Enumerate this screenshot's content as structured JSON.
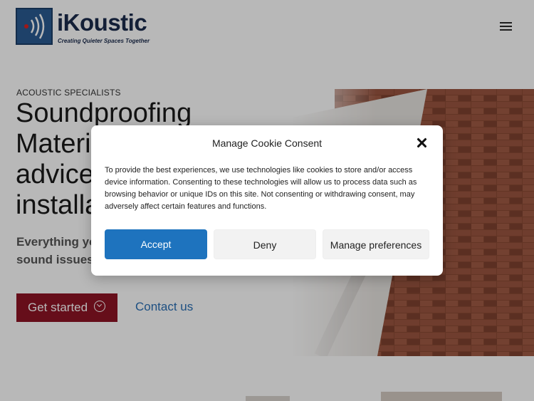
{
  "header": {
    "brand_name": "iKoustic",
    "brand_tagline": "Creating Quieter Spaces Together"
  },
  "hero": {
    "eyebrow": "ACOUSTIC SPECIALISTS",
    "title": "Soundproofing Materials, advice and installation",
    "subtitle": "Everything you need to solve your sound issues in one place.",
    "cta_primary": "Get started",
    "cta_secondary": "Contact us"
  },
  "cookie_modal": {
    "title": "Manage Cookie Consent",
    "body": "To provide the best experiences, we use technologies like cookies to store and/or access device information. Consenting to these technologies will allow us to process data such as browsing behavior or unique IDs on this site. Not consenting or withdrawing consent, may adversely affect certain features and functions.",
    "accept_label": "Accept",
    "deny_label": "Deny",
    "preferences_label": "Manage preferences"
  },
  "colors": {
    "brand_navy": "#1b2b4d",
    "cta_red": "#8e1424",
    "accept_blue": "#1e73be",
    "link_blue": "#2a6fb5"
  }
}
